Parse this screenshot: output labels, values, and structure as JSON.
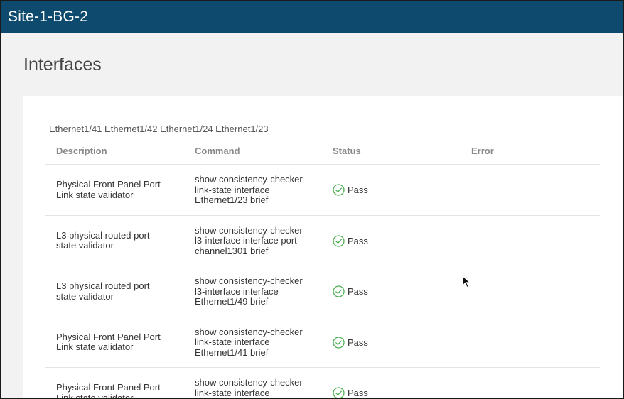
{
  "header": {
    "site_title": "Site-1-BG-2"
  },
  "page": {
    "title": "Interfaces"
  },
  "panel": {
    "interfaces": "Ethernet1/41 Ethernet1/42 Ethernet1/24 Ethernet1/23",
    "columns": {
      "description": "Description",
      "command": "Command",
      "status": "Status",
      "error": "Error"
    },
    "rows": [
      {
        "description": [
          "Physical Front Panel Port",
          "Link state validator"
        ],
        "command": [
          "show consistency-checker",
          "link-state interface",
          "Ethernet1/23 brief"
        ],
        "status": "Pass",
        "error": ""
      },
      {
        "description": [
          "L3 physical routed port",
          "state validator"
        ],
        "command": [
          "show consistency-checker",
          "l3-interface interface port-",
          "channel1301 brief"
        ],
        "status": "Pass",
        "error": ""
      },
      {
        "description": [
          "L3 physical routed port",
          "state validator"
        ],
        "command": [
          "show consistency-checker",
          "l3-interface interface",
          "Ethernet1/49 brief"
        ],
        "status": "Pass",
        "error": ""
      },
      {
        "description": [
          "Physical Front Panel Port",
          "Link state validator"
        ],
        "command": [
          "show consistency-checker",
          "link-state interface",
          "Ethernet1/41 brief"
        ],
        "status": "Pass",
        "error": ""
      },
      {
        "description": [
          "Physical Front Panel Port",
          "Link state validator"
        ],
        "command": [
          "show consistency-checker",
          "link-state interface"
        ],
        "status": "Pass",
        "error": ""
      }
    ]
  },
  "icons": {
    "status_pass": "check-circle-icon",
    "cursor": "mouse-pointer-icon"
  },
  "colors": {
    "header_bg": "#0e4a6e",
    "pass_green": "#4caf50"
  }
}
